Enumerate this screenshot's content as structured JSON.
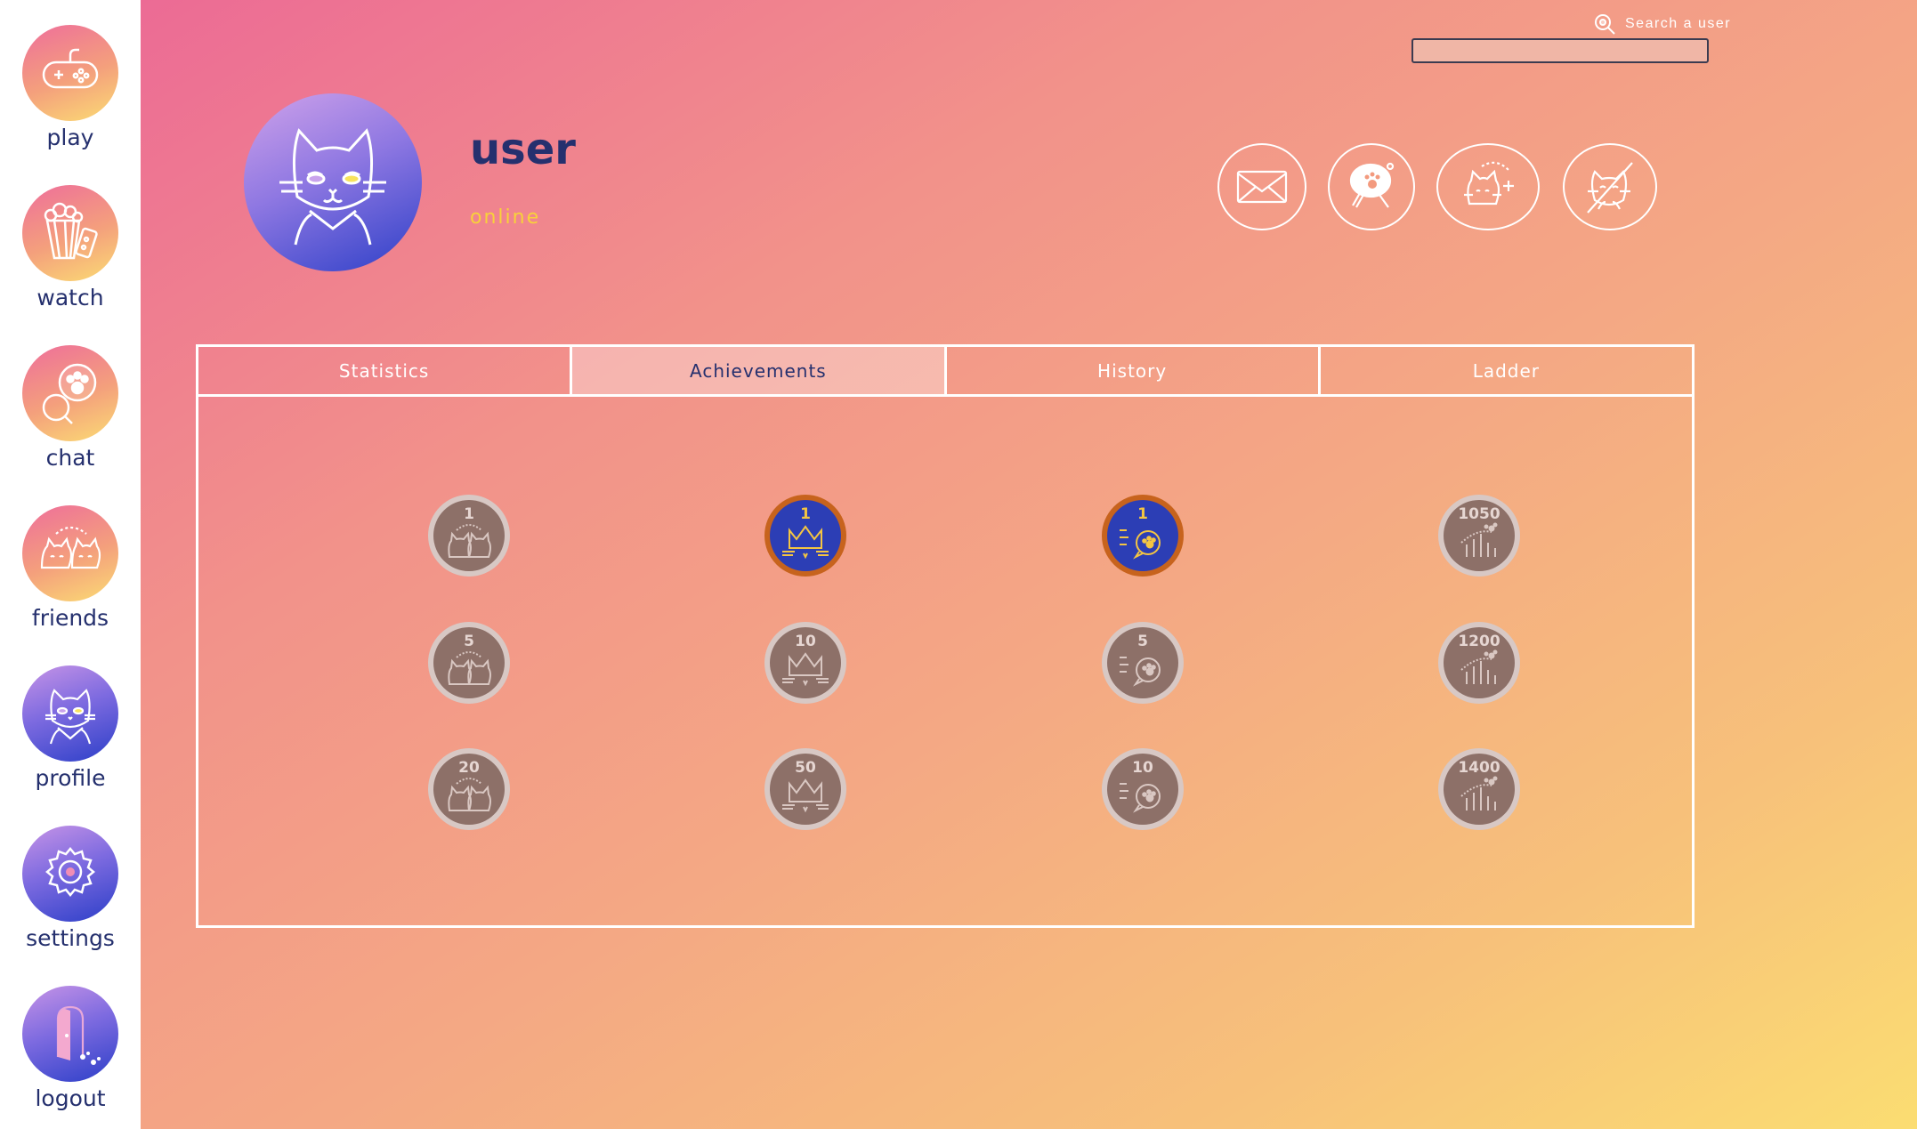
{
  "sidebar": {
    "items": [
      {
        "label": "play",
        "icon": "gamepad-icon"
      },
      {
        "label": "watch",
        "icon": "popcorn-icon"
      },
      {
        "label": "chat",
        "icon": "chat-bubbles-icon"
      },
      {
        "label": "friends",
        "icon": "cat-friends-icon"
      },
      {
        "label": "profile",
        "icon": "cat-avatar-icon"
      },
      {
        "label": "settings",
        "icon": "gear-icon"
      },
      {
        "label": "logout",
        "icon": "door-icon"
      }
    ]
  },
  "search": {
    "label": "Search a user",
    "value": "",
    "placeholder": ""
  },
  "profile": {
    "username": "user",
    "status": "online"
  },
  "actions": [
    {
      "name": "message-button",
      "icon": "envelope-icon"
    },
    {
      "name": "invite-game-button",
      "icon": "ping-pong-paddle-icon"
    },
    {
      "name": "add-friend-button",
      "icon": "cat-plus-icon"
    },
    {
      "name": "block-user-button",
      "icon": "cat-crossed-icon"
    }
  ],
  "tabs": [
    {
      "label": "Statistics",
      "active": false
    },
    {
      "label": "Achievements",
      "active": true
    },
    {
      "label": "History",
      "active": false
    },
    {
      "label": "Ladder",
      "active": false
    }
  ],
  "achievements": [
    [
      {
        "count": "1",
        "icon": "friends-cats-icon",
        "unlocked": false
      },
      {
        "count": "1",
        "icon": "crown-icon",
        "unlocked": true
      },
      {
        "count": "1",
        "icon": "chat-paw-icon",
        "unlocked": true
      },
      {
        "count": "1050",
        "icon": "ladder-chart-icon",
        "unlocked": false
      }
    ],
    [
      {
        "count": "5",
        "icon": "friends-cats-icon",
        "unlocked": false
      },
      {
        "count": "10",
        "icon": "crown-icon",
        "unlocked": false
      },
      {
        "count": "5",
        "icon": "chat-paw-icon",
        "unlocked": false
      },
      {
        "count": "1200",
        "icon": "ladder-chart-icon",
        "unlocked": false
      }
    ],
    [
      {
        "count": "20",
        "icon": "friends-cats-icon",
        "unlocked": false
      },
      {
        "count": "50",
        "icon": "crown-icon",
        "unlocked": false
      },
      {
        "count": "10",
        "icon": "chat-paw-icon",
        "unlocked": false
      },
      {
        "count": "1400",
        "icon": "ladder-chart-icon",
        "unlocked": false
      }
    ]
  ],
  "colors": {
    "navy": "#25306e",
    "status_online": "#f8d13a",
    "unlocked_medal": "#2c3eb5",
    "unlocked_rim": "#c7631d",
    "locked_medal": "#8d7068",
    "locked_rim": "#d8c8c4"
  }
}
